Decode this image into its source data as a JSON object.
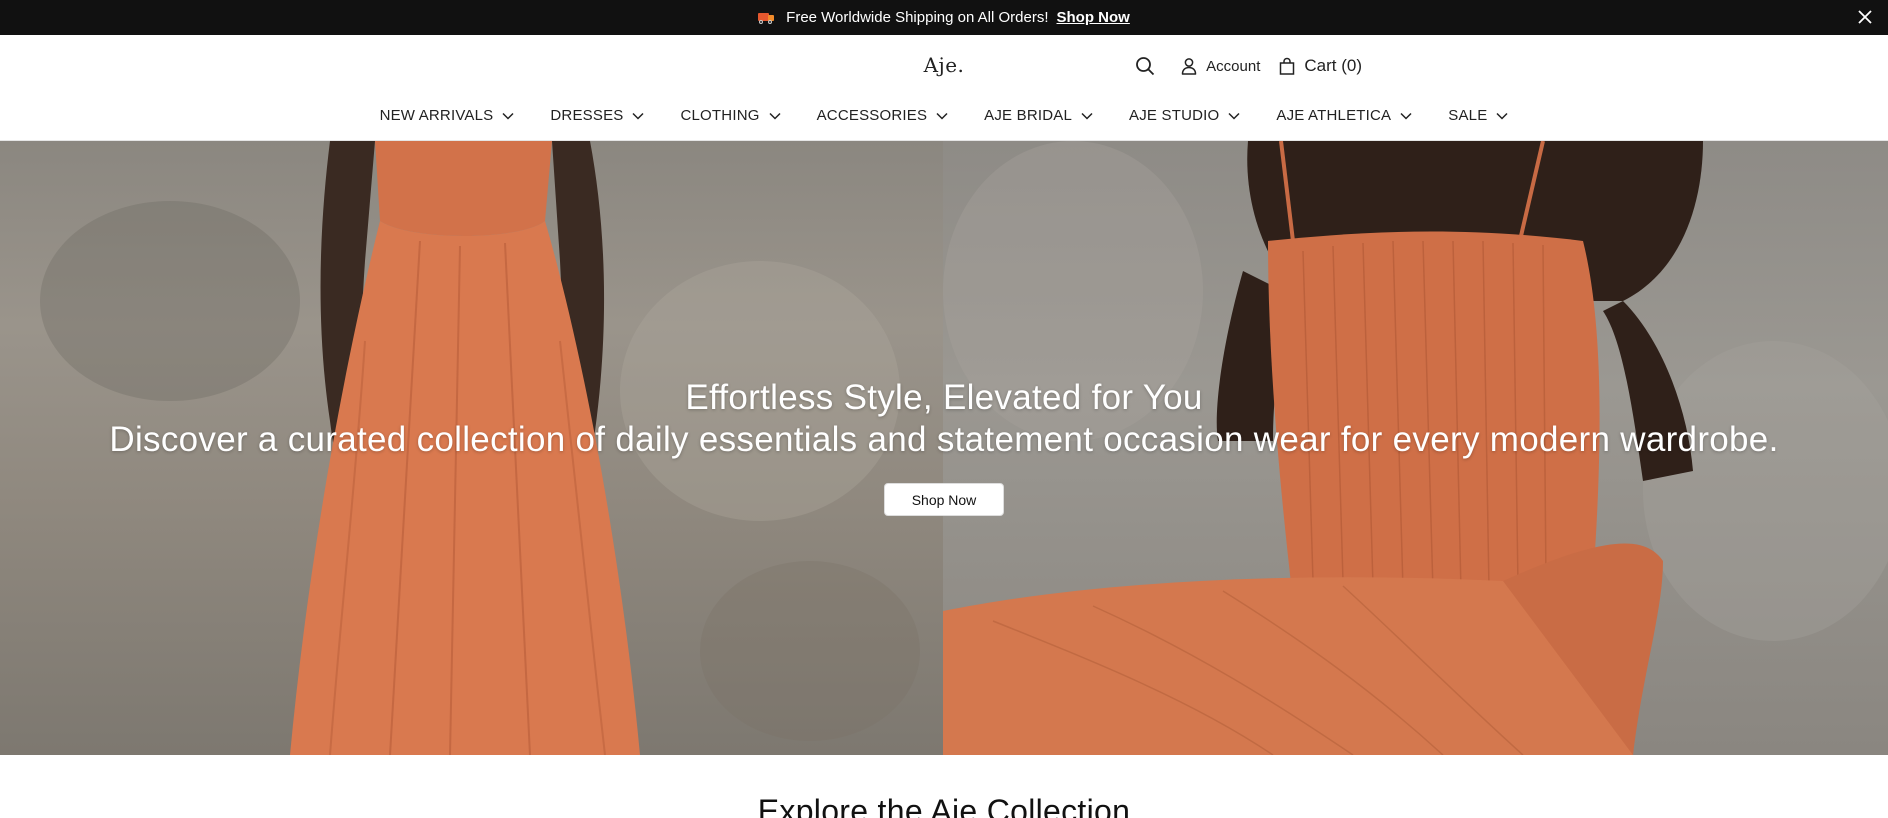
{
  "announcement": {
    "emoji": "truck-emoji",
    "text": "Free Worldwide Shipping on All Orders!",
    "link_label": "Shop Now",
    "close_icon": "close-icon"
  },
  "header": {
    "logo": "Aje.",
    "account_label": "Account",
    "cart_label": "Cart (0)",
    "icons": [
      "search-icon",
      "user-icon",
      "shopping-bag-icon"
    ]
  },
  "nav": {
    "items": [
      {
        "label": "NEW ARRIVALS"
      },
      {
        "label": "DRESSES"
      },
      {
        "label": "CLOTHING"
      },
      {
        "label": "ACCESSORIES"
      },
      {
        "label": "AJE BRIDAL"
      },
      {
        "label": "AJE STUDIO"
      },
      {
        "label": "AJE ATHLETICA"
      },
      {
        "label": "SALE"
      }
    ]
  },
  "hero": {
    "title": "Effortless Style, Elevated for You",
    "subtitle": "Discover a curated collection of daily essentials and statement occasion wear for every modern wardrobe.",
    "button_label": "Shop Now"
  },
  "section": {
    "title": "Explore the Aje Collection"
  },
  "colors": {
    "announcement_bg": "#111111",
    "dress_orange": "#d9794f",
    "wall_grey": "#938e86"
  }
}
